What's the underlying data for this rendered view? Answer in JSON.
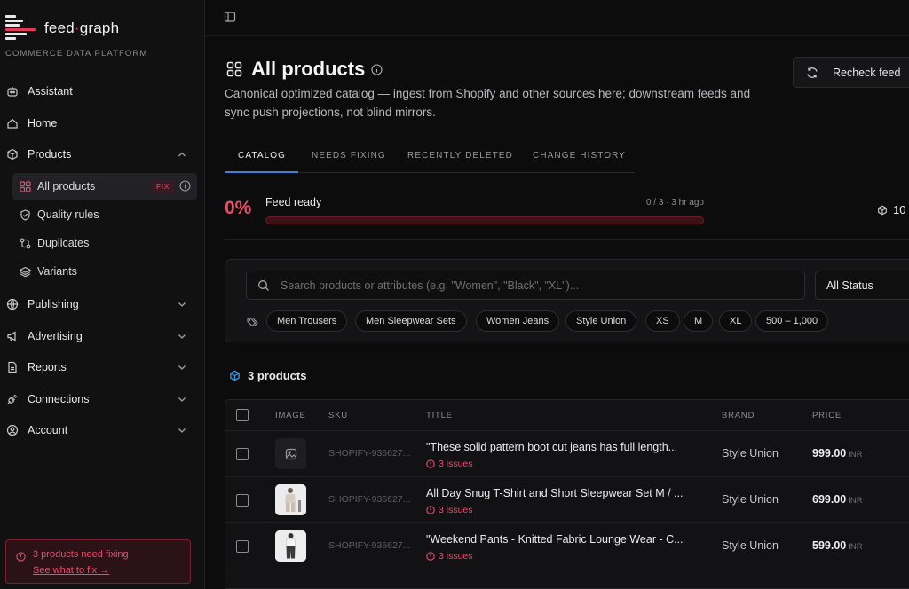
{
  "brand": {
    "name_left": "feed",
    "name_dot": "·",
    "name_right": "graph",
    "tagline": "COMMERCE DATA PLATFORM"
  },
  "sidebar": {
    "items": [
      {
        "label": "Assistant",
        "icon": "assistant-icon"
      },
      {
        "label": "Home",
        "icon": "home-icon"
      },
      {
        "label": "Products",
        "icon": "box-icon",
        "expanded": true
      },
      {
        "label": "Publishing",
        "icon": "globe-icon"
      },
      {
        "label": "Advertising",
        "icon": "megaphone-icon"
      },
      {
        "label": "Reports",
        "icon": "report-icon"
      },
      {
        "label": "Connections",
        "icon": "plug-icon"
      },
      {
        "label": "Account",
        "icon": "user-icon"
      }
    ],
    "products_sub": [
      {
        "label": "All products",
        "badge": "FIX"
      },
      {
        "label": "Quality rules"
      },
      {
        "label": "Duplicates"
      },
      {
        "label": "Variants"
      }
    ],
    "alert": {
      "text": "3 products need fixing",
      "link": "See what to fix →"
    }
  },
  "header": {
    "title": "All products",
    "description": "Canonical optimized catalog — ingest from Shopify and other sources here; downstream feeds and sync push projections, not blind mirrors.",
    "recheck_label": "Recheck feed"
  },
  "tabs": [
    "CATALOG",
    "NEEDS FIXING",
    "RECENTLY DELETED",
    "CHANGE HISTORY"
  ],
  "feed": {
    "percent": "0%",
    "label": "Feed ready",
    "meta": "0 / 3 · 3 hr ago",
    "progress": 0,
    "count": "10"
  },
  "filters": {
    "search_placeholder": "Search products or attributes (e.g. \"Women\", \"Black\", \"XL\")...",
    "status": "All Status",
    "chips": [
      "Men Trousers",
      "Men Sleepwear Sets",
      "Women Jeans",
      "Style Union",
      "XS",
      "M",
      "XL",
      "500 – 1,000"
    ]
  },
  "products": {
    "count_label": "3 products",
    "columns": [
      "IMAGE",
      "SKU",
      "TITLE",
      "BRAND",
      "PRICE"
    ],
    "rows": [
      {
        "sku": "SHOPIFY-936627...",
        "title": "\"These solid pattern boot cut jeans has full length...",
        "issues": "3 issues",
        "brand": "Style Union",
        "price": "999.00",
        "currency": "INR",
        "image": "placeholder-icon"
      },
      {
        "sku": "SHOPIFY-936627...",
        "title": "All Day Snug T-Shirt and Short Sleepwear Set M / ...",
        "issues": "3 issues",
        "brand": "Style Union",
        "price": "699.00",
        "currency": "INR",
        "image": "product-photo"
      },
      {
        "sku": "SHOPIFY-936627...",
        "title": "\"Weekend Pants - Knitted Fabric Lounge Wear - C...",
        "issues": "3 issues",
        "brand": "Style Union",
        "price": "599.00",
        "currency": "INR",
        "image": "product-photo"
      }
    ]
  },
  "colors": {
    "accent": "#e84d6e",
    "tab_active": "#3b82d6",
    "background": "#0c0c0d"
  }
}
